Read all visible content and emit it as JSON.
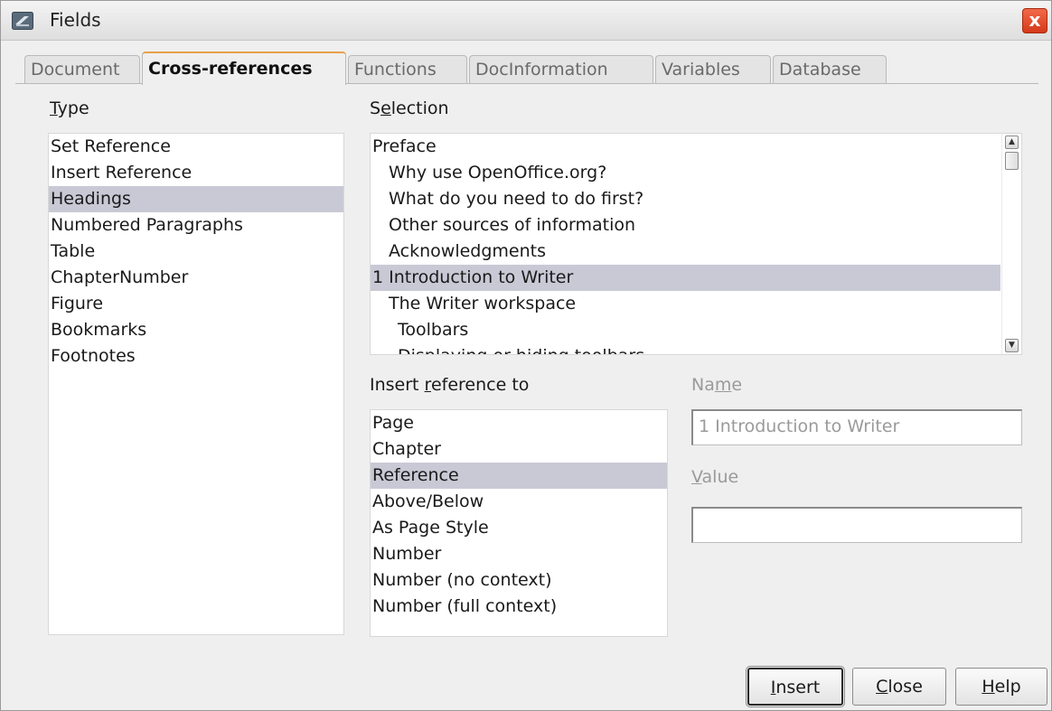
{
  "window": {
    "title": "Fields",
    "close_glyph": "x"
  },
  "tabs": [
    {
      "label": "Document",
      "active": false
    },
    {
      "label": "Cross-references",
      "active": true
    },
    {
      "label": "Functions",
      "active": false
    },
    {
      "label": "DocInformation",
      "active": false
    },
    {
      "label": "Variables",
      "active": false
    },
    {
      "label": "Database",
      "active": false
    }
  ],
  "type_panel": {
    "label_prefix": "",
    "label_mnemonic": "T",
    "label_rest": "ype",
    "items": [
      "Set Reference",
      "Insert Reference",
      "Headings",
      "Numbered Paragraphs",
      "Table",
      "ChapterNumber",
      "Figure",
      "Bookmarks",
      "Footnotes"
    ],
    "selected": "Headings"
  },
  "selection_panel": {
    "label_prefix": "S",
    "label_mnemonic": "e",
    "label_rest": "lection",
    "items": [
      {
        "text": "Preface",
        "level": 0
      },
      {
        "text": "Why use OpenOffice.org?",
        "level": 1
      },
      {
        "text": "What do you need to do first?",
        "level": 1
      },
      {
        "text": "Other sources of information",
        "level": 1
      },
      {
        "text": "Acknowledgments",
        "level": 1
      },
      {
        "text": "1 Introduction to Writer",
        "level": 0
      },
      {
        "text": "The Writer workspace",
        "level": 1
      },
      {
        "text": "Toolbars",
        "level": 2
      },
      {
        "text": "Displaying or hiding toolbars",
        "level": 2
      }
    ],
    "selected": "1 Introduction to Writer",
    "scroll_up_icon": "scroll-up-arrow-icon",
    "scroll_down_icon": "scroll-down-arrow-icon"
  },
  "insert_ref_panel": {
    "label_prefix": "Insert ",
    "label_mnemonic": "r",
    "label_rest": "eference to",
    "items": [
      "Page",
      "Chapter",
      "Reference",
      "Above/Below",
      "As Page Style",
      "Number",
      "Number (no context)",
      "Number (full context)"
    ],
    "selected": "Reference"
  },
  "name_field": {
    "label_prefix": "Na",
    "label_mnemonic": "m",
    "label_rest": "e",
    "value": "1 Introduction to Writer"
  },
  "value_field": {
    "label_prefix": "",
    "label_mnemonic": "V",
    "label_rest": "alue",
    "value": ""
  },
  "buttons": {
    "insert": {
      "mnemonic": "I",
      "rest": "nsert"
    },
    "close": {
      "mnemonic": "C",
      "rest": "lose"
    },
    "help": {
      "mnemonic": "H",
      "rest": "elp"
    }
  },
  "colors": {
    "selection_highlight": "#c9c9d6",
    "active_tab_accent": "#e8a04a",
    "close_button": "#d43a1a"
  }
}
